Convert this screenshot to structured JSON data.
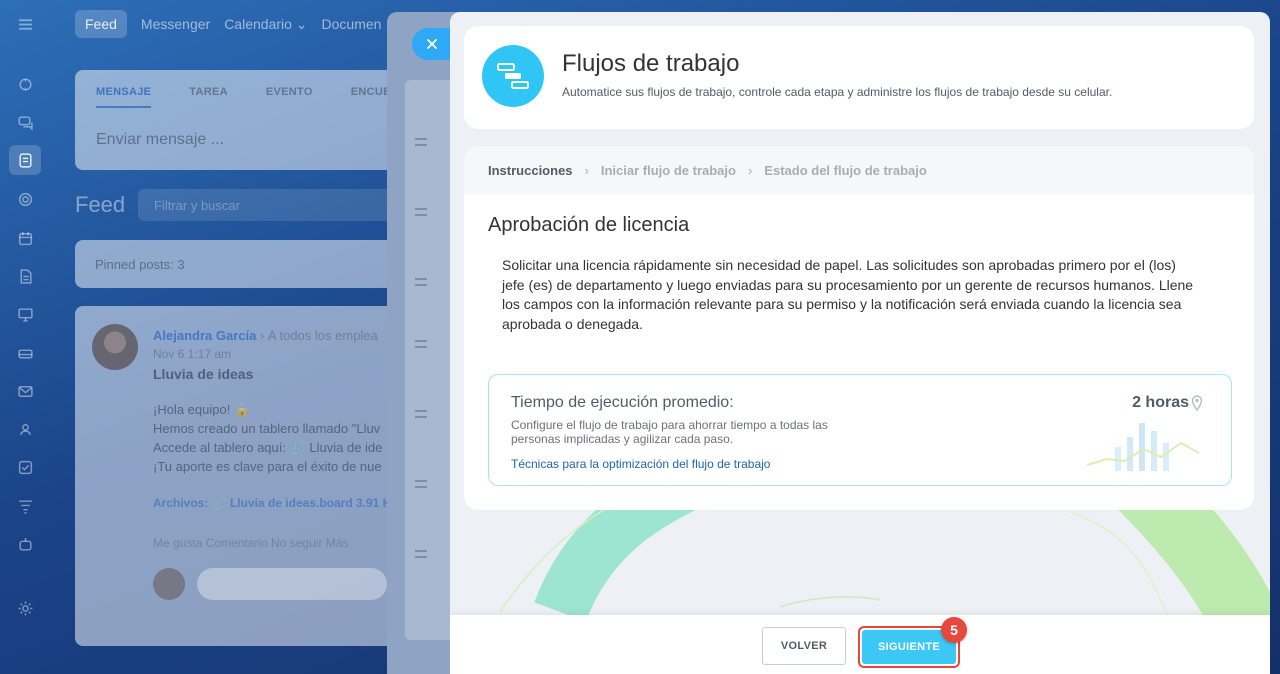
{
  "nav": {
    "items": [
      "Feed",
      "Messenger",
      "Calendario",
      "Documen"
    ]
  },
  "composer": {
    "tabs": [
      "MENSAJE",
      "TAREA",
      "EVENTO",
      "ENCUE"
    ],
    "placeholder": "Enviar mensaje ..."
  },
  "feed": {
    "title": "Feed",
    "filter_placeholder": "Filtrar y buscar",
    "pinned": "Pinned posts: 3"
  },
  "post": {
    "author": "Alejandra García",
    "recipient": "A todos los emplea",
    "date": "Nov 6 1:17 am",
    "title": "Lluvia de ideas",
    "lines": [
      "¡Hola equipo! 🔒",
      "Hemos creado un tablero llamado \"Lluv",
      "Accede al tablero aquí: 🔗 Lluvia de ide",
      "¡Tu aporte es clave para el éxito de nue"
    ],
    "files": "Archivos: 🔗 Lluvia de ideas.board 3.91 K",
    "actions": "Me gusta   Comentario   No seguir   Más"
  },
  "slider": {
    "title": "Flujos de trabajo",
    "subtitle": "Automatice sus flujos de trabajo, controle cada etapa y administre los flujos de trabajo desde su celular.",
    "breadcrumbs": [
      "Instrucciones",
      "Iniciar flujo de trabajo",
      "Estado del flujo de trabajo"
    ],
    "card_title": "Aprobación de licencia",
    "description": "Solicitar una licencia rápidamente sin necesidad de papel. Las solicitudes son aprobadas primero por el (los) jefe (es) de departamento y luego enviadas para su procesamiento por un gerente de recursos humanos. Llene los campos con la información relevante para su permiso y la notificación será enviada cuando la licencia sea aprobada o denegada.",
    "time": {
      "label": "Tiempo de ejecución promedio:",
      "note": "Configure el flujo de trabajo para ahorrar tiempo a todas las personas implicadas y agilizar cada paso.",
      "link": "Técnicas para la optimización del flujo de trabajo",
      "value": "2 horas"
    },
    "buttons": {
      "back": "VOLVER",
      "next": "SIGUIENTE"
    },
    "step_badge": "5"
  },
  "colors": {
    "accent": "#2fc6f6",
    "next_button": "#3bc8f5",
    "highlight": "#e8473d",
    "link": "#2066b0"
  }
}
